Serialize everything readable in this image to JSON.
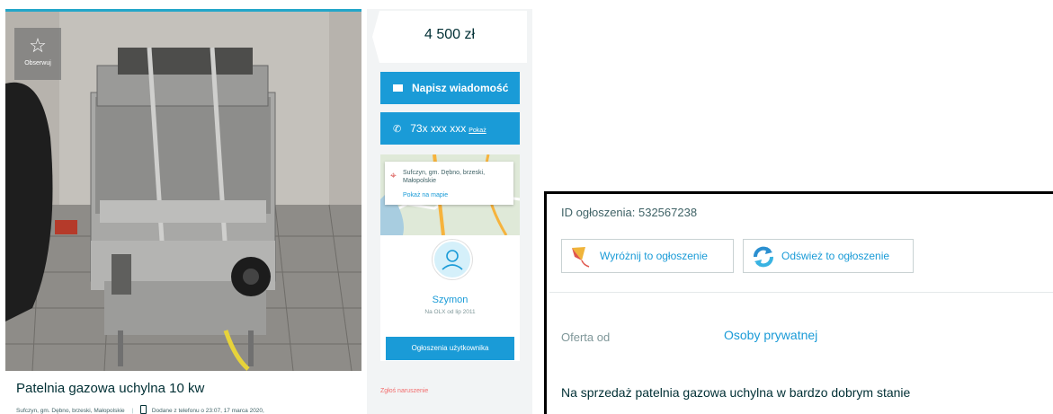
{
  "listing": {
    "observe_label": "Obserwuj",
    "title": "Patelnia gazowa uchylna 10 kw",
    "location_line": "Sufczyn, gm. Dębno, brzeski, Małopolskie",
    "added_line": "Dodane z telefonu  o 23:07, 17 marca 2020,"
  },
  "sidebar": {
    "price": "4 500 zł",
    "message_button": "Napisz wiadomość",
    "phone_masked": "73x xxx xxx",
    "phone_show": "Pokaż",
    "location": "Sufczyn, gm. Dębno, brzeski, Małopolskie",
    "map_link": "Pokaż na mapie",
    "user_name": "Szymon",
    "user_since": "Na OLX od lip 2011",
    "user_ads_button": "Ogłoszenia użytkownika",
    "report_link": "Zgłoś naruszenie"
  },
  "details": {
    "ad_id": "ID ogłoszenia: 532567238",
    "promote_button": "Wyróżnij to ogłoszenie",
    "refresh_button": "Odśwież to ogłoszenie",
    "offer_label": "Oferta od",
    "offer_value": "Osoby prywatnej",
    "description": "Na sprzedaż patelnia gazowa uchylna w bardzo dobrym stanie"
  },
  "colors": {
    "accent": "#1a9bd7",
    "text": "#002f34",
    "report": "#f36c6c"
  }
}
